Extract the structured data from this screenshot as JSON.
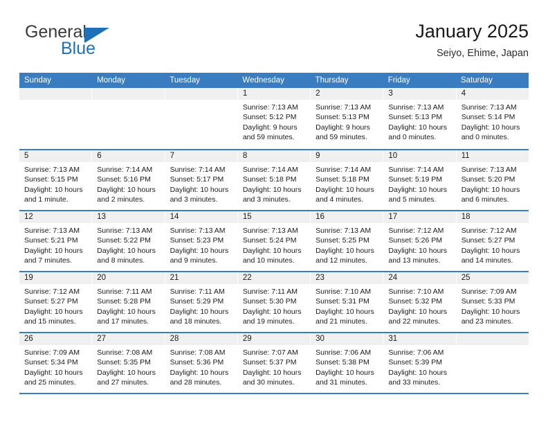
{
  "brand": {
    "name_top": "General",
    "name_bottom": "Blue",
    "triangle_icon": "triangle-icon",
    "color_dark": "#3a3a3a",
    "color_blue": "#1e71b8"
  },
  "header": {
    "title": "January 2025",
    "subtitle": "Seiyo, Ehime, Japan"
  },
  "theme": {
    "header_bg": "#3a7cc0",
    "header_text": "#ffffff",
    "daynum_bg": "#f0f0f0",
    "cell_bg": "#ffffff",
    "rule": "#3a7cc0"
  },
  "weekdays": [
    "Sunday",
    "Monday",
    "Tuesday",
    "Wednesday",
    "Thursday",
    "Friday",
    "Saturday"
  ],
  "labels": {
    "sunrise_prefix": "Sunrise:",
    "sunset_prefix": "Sunset:",
    "daylight_prefix": "Daylight:"
  },
  "weeks": [
    [
      {
        "day": "",
        "sunrise": "",
        "sunset": "",
        "daylight": "",
        "empty": true
      },
      {
        "day": "",
        "sunrise": "",
        "sunset": "",
        "daylight": "",
        "empty": true
      },
      {
        "day": "",
        "sunrise": "",
        "sunset": "",
        "daylight": "",
        "empty": true
      },
      {
        "day": "1",
        "sunrise": "Sunrise: 7:13 AM",
        "sunset": "Sunset: 5:12 PM",
        "daylight": "Daylight: 9 hours and 59 minutes.",
        "empty": false
      },
      {
        "day": "2",
        "sunrise": "Sunrise: 7:13 AM",
        "sunset": "Sunset: 5:13 PM",
        "daylight": "Daylight: 9 hours and 59 minutes.",
        "empty": false
      },
      {
        "day": "3",
        "sunrise": "Sunrise: 7:13 AM",
        "sunset": "Sunset: 5:13 PM",
        "daylight": "Daylight: 10 hours and 0 minutes.",
        "empty": false
      },
      {
        "day": "4",
        "sunrise": "Sunrise: 7:13 AM",
        "sunset": "Sunset: 5:14 PM",
        "daylight": "Daylight: 10 hours and 0 minutes.",
        "empty": false
      }
    ],
    [
      {
        "day": "5",
        "sunrise": "Sunrise: 7:13 AM",
        "sunset": "Sunset: 5:15 PM",
        "daylight": "Daylight: 10 hours and 1 minute.",
        "empty": false
      },
      {
        "day": "6",
        "sunrise": "Sunrise: 7:14 AM",
        "sunset": "Sunset: 5:16 PM",
        "daylight": "Daylight: 10 hours and 2 minutes.",
        "empty": false
      },
      {
        "day": "7",
        "sunrise": "Sunrise: 7:14 AM",
        "sunset": "Sunset: 5:17 PM",
        "daylight": "Daylight: 10 hours and 3 minutes.",
        "empty": false
      },
      {
        "day": "8",
        "sunrise": "Sunrise: 7:14 AM",
        "sunset": "Sunset: 5:18 PM",
        "daylight": "Daylight: 10 hours and 3 minutes.",
        "empty": false
      },
      {
        "day": "9",
        "sunrise": "Sunrise: 7:14 AM",
        "sunset": "Sunset: 5:18 PM",
        "daylight": "Daylight: 10 hours and 4 minutes.",
        "empty": false
      },
      {
        "day": "10",
        "sunrise": "Sunrise: 7:14 AM",
        "sunset": "Sunset: 5:19 PM",
        "daylight": "Daylight: 10 hours and 5 minutes.",
        "empty": false
      },
      {
        "day": "11",
        "sunrise": "Sunrise: 7:13 AM",
        "sunset": "Sunset: 5:20 PM",
        "daylight": "Daylight: 10 hours and 6 minutes.",
        "empty": false
      }
    ],
    [
      {
        "day": "12",
        "sunrise": "Sunrise: 7:13 AM",
        "sunset": "Sunset: 5:21 PM",
        "daylight": "Daylight: 10 hours and 7 minutes.",
        "empty": false
      },
      {
        "day": "13",
        "sunrise": "Sunrise: 7:13 AM",
        "sunset": "Sunset: 5:22 PM",
        "daylight": "Daylight: 10 hours and 8 minutes.",
        "empty": false
      },
      {
        "day": "14",
        "sunrise": "Sunrise: 7:13 AM",
        "sunset": "Sunset: 5:23 PM",
        "daylight": "Daylight: 10 hours and 9 minutes.",
        "empty": false
      },
      {
        "day": "15",
        "sunrise": "Sunrise: 7:13 AM",
        "sunset": "Sunset: 5:24 PM",
        "daylight": "Daylight: 10 hours and 10 minutes.",
        "empty": false
      },
      {
        "day": "16",
        "sunrise": "Sunrise: 7:13 AM",
        "sunset": "Sunset: 5:25 PM",
        "daylight": "Daylight: 10 hours and 12 minutes.",
        "empty": false
      },
      {
        "day": "17",
        "sunrise": "Sunrise: 7:12 AM",
        "sunset": "Sunset: 5:26 PM",
        "daylight": "Daylight: 10 hours and 13 minutes.",
        "empty": false
      },
      {
        "day": "18",
        "sunrise": "Sunrise: 7:12 AM",
        "sunset": "Sunset: 5:27 PM",
        "daylight": "Daylight: 10 hours and 14 minutes.",
        "empty": false
      }
    ],
    [
      {
        "day": "19",
        "sunrise": "Sunrise: 7:12 AM",
        "sunset": "Sunset: 5:27 PM",
        "daylight": "Daylight: 10 hours and 15 minutes.",
        "empty": false
      },
      {
        "day": "20",
        "sunrise": "Sunrise: 7:11 AM",
        "sunset": "Sunset: 5:28 PM",
        "daylight": "Daylight: 10 hours and 17 minutes.",
        "empty": false
      },
      {
        "day": "21",
        "sunrise": "Sunrise: 7:11 AM",
        "sunset": "Sunset: 5:29 PM",
        "daylight": "Daylight: 10 hours and 18 minutes.",
        "empty": false
      },
      {
        "day": "22",
        "sunrise": "Sunrise: 7:11 AM",
        "sunset": "Sunset: 5:30 PM",
        "daylight": "Daylight: 10 hours and 19 minutes.",
        "empty": false
      },
      {
        "day": "23",
        "sunrise": "Sunrise: 7:10 AM",
        "sunset": "Sunset: 5:31 PM",
        "daylight": "Daylight: 10 hours and 21 minutes.",
        "empty": false
      },
      {
        "day": "24",
        "sunrise": "Sunrise: 7:10 AM",
        "sunset": "Sunset: 5:32 PM",
        "daylight": "Daylight: 10 hours and 22 minutes.",
        "empty": false
      },
      {
        "day": "25",
        "sunrise": "Sunrise: 7:09 AM",
        "sunset": "Sunset: 5:33 PM",
        "daylight": "Daylight: 10 hours and 23 minutes.",
        "empty": false
      }
    ],
    [
      {
        "day": "26",
        "sunrise": "Sunrise: 7:09 AM",
        "sunset": "Sunset: 5:34 PM",
        "daylight": "Daylight: 10 hours and 25 minutes.",
        "empty": false
      },
      {
        "day": "27",
        "sunrise": "Sunrise: 7:08 AM",
        "sunset": "Sunset: 5:35 PM",
        "daylight": "Daylight: 10 hours and 27 minutes.",
        "empty": false
      },
      {
        "day": "28",
        "sunrise": "Sunrise: 7:08 AM",
        "sunset": "Sunset: 5:36 PM",
        "daylight": "Daylight: 10 hours and 28 minutes.",
        "empty": false
      },
      {
        "day": "29",
        "sunrise": "Sunrise: 7:07 AM",
        "sunset": "Sunset: 5:37 PM",
        "daylight": "Daylight: 10 hours and 30 minutes.",
        "empty": false
      },
      {
        "day": "30",
        "sunrise": "Sunrise: 7:06 AM",
        "sunset": "Sunset: 5:38 PM",
        "daylight": "Daylight: 10 hours and 31 minutes.",
        "empty": false
      },
      {
        "day": "31",
        "sunrise": "Sunrise: 7:06 AM",
        "sunset": "Sunset: 5:39 PM",
        "daylight": "Daylight: 10 hours and 33 minutes.",
        "empty": false
      },
      {
        "day": "",
        "sunrise": "",
        "sunset": "",
        "daylight": "",
        "empty": true
      }
    ]
  ]
}
